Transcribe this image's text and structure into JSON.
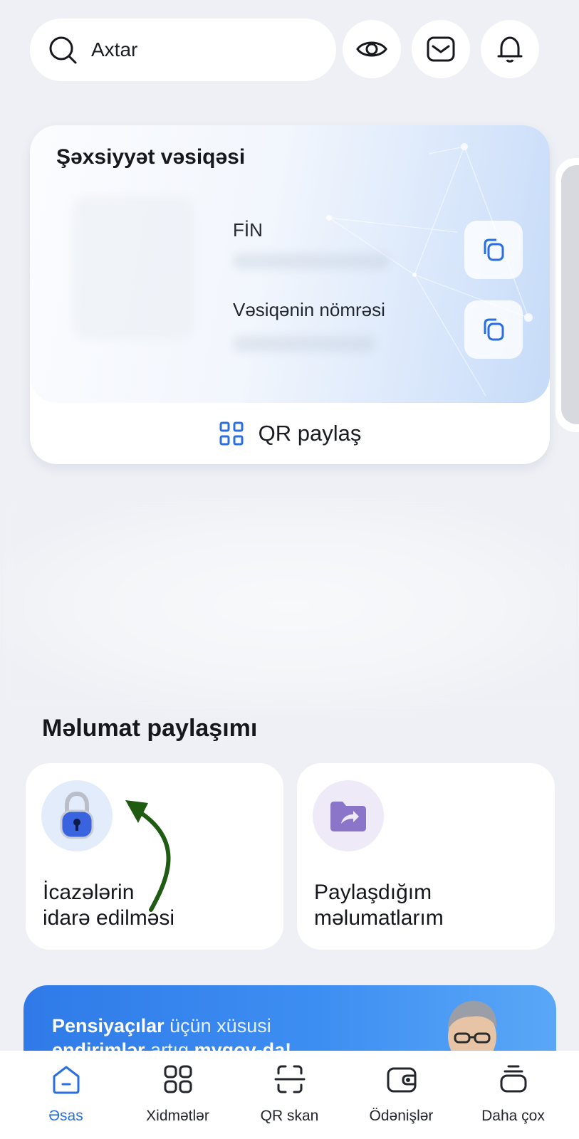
{
  "search": {
    "placeholder": "Axtar"
  },
  "header": {
    "icons": [
      "eye-icon",
      "mail-icon",
      "bell-icon"
    ]
  },
  "id_card": {
    "title": "Şəxsiyyət vəsiqəsi",
    "fields": [
      {
        "label": "FİN"
      },
      {
        "label": "Vəsiqənin nömrəsi"
      }
    ],
    "qr_share_label": "QR paylaş"
  },
  "data_sharing": {
    "title": "Məlumat paylaşımı",
    "tiles": [
      {
        "line1": "İcazələrin",
        "line2": "idarə edilməsi",
        "icon": "lock-icon"
      },
      {
        "line1": "Paylaşdığım",
        "line2": "məlumatlarım",
        "icon": "shared-folder-icon"
      }
    ]
  },
  "promo": {
    "bold1": "Pensiyaçılar",
    "text1": " üçün xüsusi",
    "bold2": "endirimlər",
    "text2": " artıq ",
    "bold3": "mygov-da!"
  },
  "tabs": [
    {
      "label": "Əsas",
      "icon": "home-icon",
      "active": true
    },
    {
      "label": "Xidmətlər",
      "icon": "grid-icon"
    },
    {
      "label": "QR skan",
      "icon": "qr-scan-icon"
    },
    {
      "label": "Ödənişlər",
      "icon": "wallet-icon"
    },
    {
      "label": "Daha çox",
      "icon": "stack-icon"
    }
  ],
  "colors": {
    "accent": "#2a6fe0",
    "background": "#eef0f5"
  }
}
